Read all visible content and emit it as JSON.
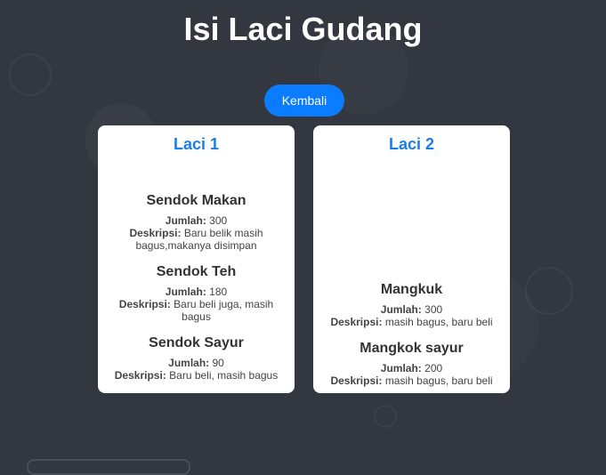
{
  "page": {
    "title": "Isi Laci Gudang",
    "back_label": "Kembali"
  },
  "labels": {
    "quantity": "Jumlah:",
    "description": "Deskripsi:"
  },
  "drawers": [
    {
      "title": "Laci 1",
      "items": [
        {
          "name": "Sendok Makan",
          "quantity": "300",
          "description": "Baru belik masih bagus,makanya disimpan"
        },
        {
          "name": "Sendok Teh",
          "quantity": "180",
          "description": "Baru beli juga, masih bagus"
        },
        {
          "name": "Sendok Sayur",
          "quantity": "90",
          "description": "Baru beli, masih bagus"
        }
      ]
    },
    {
      "title": "Laci 2",
      "items": [
        {
          "name": "Mangkuk",
          "quantity": "300",
          "description": "masih bagus, baru beli"
        },
        {
          "name": "Mangkok sayur",
          "quantity": "200",
          "description": "masih bagus, baru beli"
        }
      ]
    }
  ],
  "colors": {
    "background": "#323740",
    "accent": "#0a7cff",
    "drawer_title": "#1a7ee6"
  }
}
